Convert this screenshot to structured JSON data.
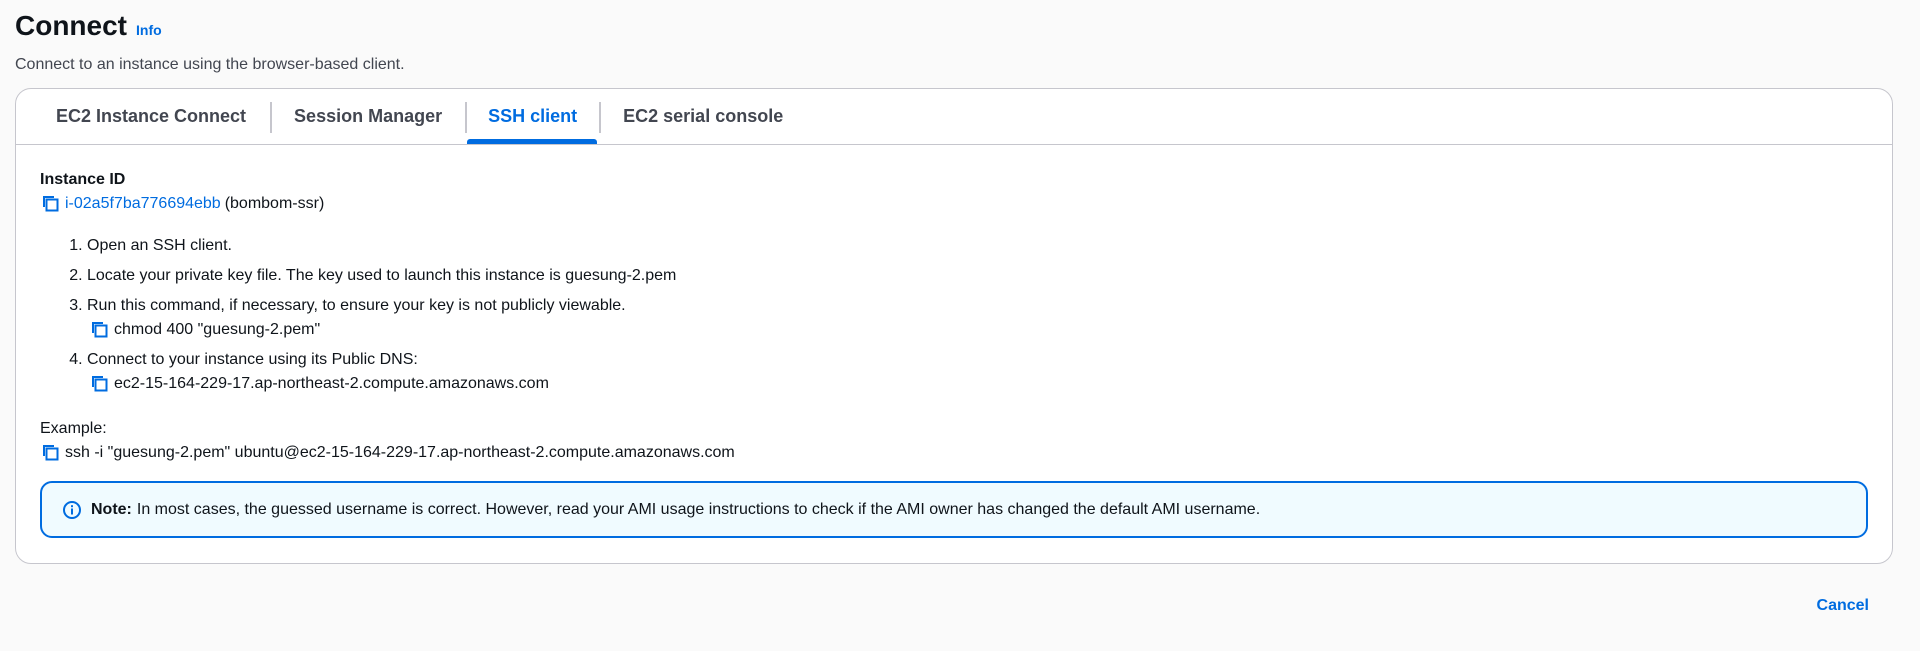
{
  "header": {
    "title": "Connect",
    "info_label": "Info",
    "description": "Connect to an instance using the browser-based client."
  },
  "tabs": [
    {
      "label": "EC2 Instance Connect",
      "active": false
    },
    {
      "label": "Session Manager",
      "active": false
    },
    {
      "label": "SSH client",
      "active": true
    },
    {
      "label": "EC2 serial console",
      "active": false
    }
  ],
  "instance": {
    "label": "Instance ID",
    "id": "i-02a5f7ba776694ebb",
    "name": "(bombom-ssr)"
  },
  "steps": [
    {
      "text": "Open an SSH client."
    },
    {
      "text": "Locate your private key file. The key used to launch this instance is guesung-2.pem"
    },
    {
      "text": "Run this command, if necessary, to ensure your key is not publicly viewable.",
      "command": "chmod 400 \"guesung-2.pem\""
    },
    {
      "text": "Connect to your instance using its Public DNS:",
      "command": "ec2-15-164-229-17.ap-northeast-2.compute.amazonaws.com"
    }
  ],
  "example": {
    "label": "Example:",
    "command": "ssh -i \"guesung-2.pem\" ubuntu@ec2-15-164-229-17.ap-northeast-2.compute.amazonaws.com"
  },
  "note": {
    "label": "Note:",
    "text": "In most cases, the guessed username is correct. However, read your AMI usage instructions to check if the AMI owner has changed the default AMI username.",
    "icon": "info-circle-icon"
  },
  "footer": {
    "cancel_label": "Cancel"
  },
  "colors": {
    "accent": "#006ce0",
    "note_bg": "#f0fbff",
    "border": "#c6c6cd"
  }
}
